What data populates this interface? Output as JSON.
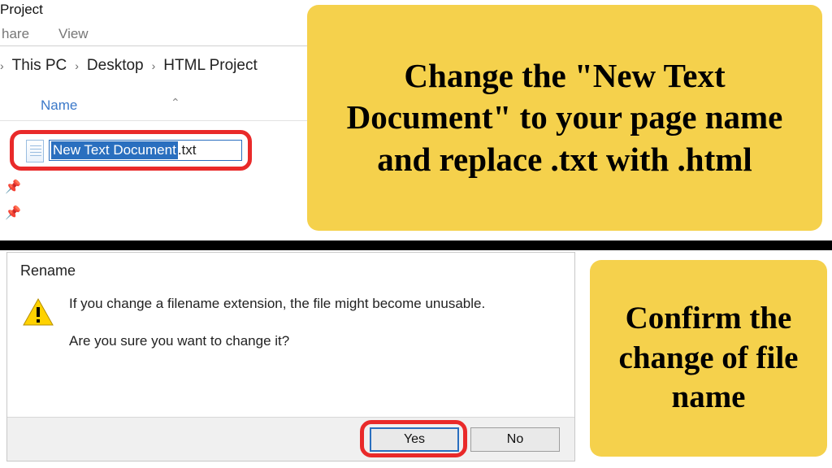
{
  "explorer": {
    "title_suffix": "Project",
    "ribbon": {
      "share": "hare",
      "view": "View"
    },
    "breadcrumb": {
      "b1": "This PC",
      "b2": "Desktop",
      "b3": "HTML Project"
    },
    "column_header": "Name",
    "file": {
      "selected_name": "New Text Document",
      "extension": ".txt"
    }
  },
  "annotations": {
    "top": "Change the \"New Text Document\" to your page name and replace .txt with .html",
    "bottom": "Confirm the change of file name"
  },
  "dialog": {
    "title": "Rename",
    "message1": "If you change a filename extension, the file might become unusable.",
    "message2": "Are you sure you want to change it?",
    "yes": "Yes",
    "no": "No"
  }
}
